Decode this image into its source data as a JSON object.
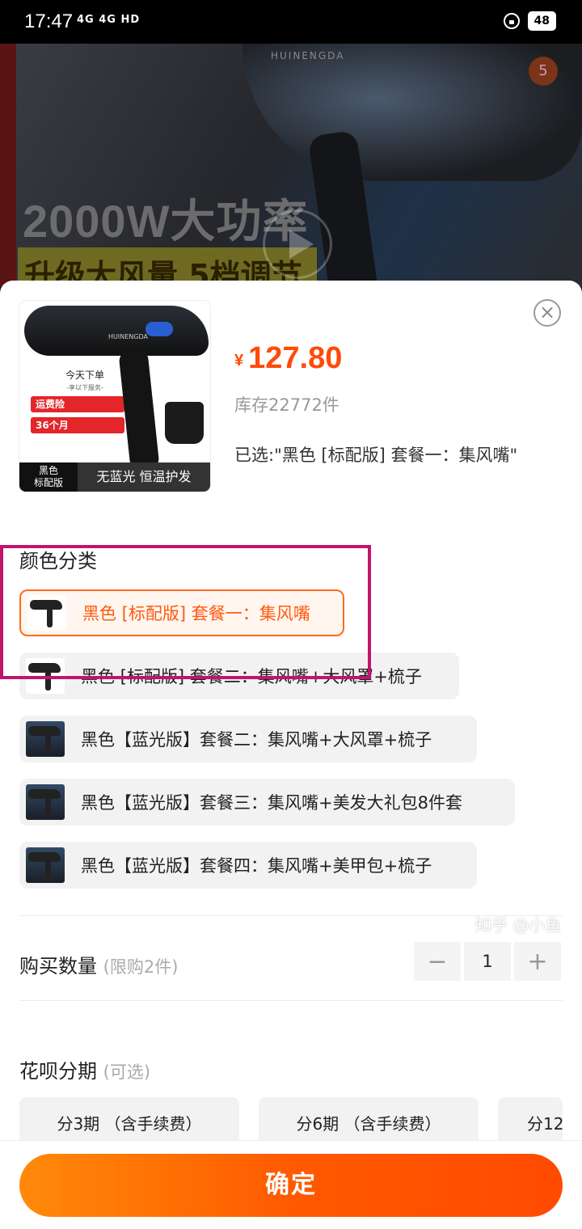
{
  "status_bar": {
    "time": "17:47",
    "signal": "4G 4G HD",
    "battery": "48"
  },
  "background": {
    "brand": "HUINENGDA",
    "headline": "2000W大功率",
    "subline": "升级大风量 5档调节",
    "badge_count": "5"
  },
  "sheet": {
    "close_label": "×",
    "thumbnail": {
      "brand": "HUINENGDA",
      "promo_title": "今天下单",
      "promo_sub": "-享以下服务-",
      "tag1": "运费险",
      "tag2": "36个月",
      "foot_left": "黑色\n标配版",
      "foot_right": "无蓝光 恒温护发"
    },
    "currency": "¥",
    "price": "127.80",
    "stock": "库存22772件",
    "selected": "已选:\"黑色 [标配版] 套餐一：集风嘴\"",
    "color_section_title": "颜色分类",
    "options": [
      {
        "label": "黑色 [标配版] 套餐一：集风嘴",
        "active": true
      },
      {
        "label": "黑色 [标配版] 套餐二：集风嘴+大风罩+梳子",
        "active": false
      },
      {
        "label": "黑色【蓝光版】套餐二：集风嘴+大风罩+梳子",
        "active": false
      },
      {
        "label": "黑色【蓝光版】套餐三：集风嘴+美发大礼包8件套",
        "active": false
      },
      {
        "label": "黑色【蓝光版】套餐四：集风嘴+美甲包+梳子",
        "active": false
      }
    ],
    "quantity_title": "购买数量",
    "quantity_hint": "(限购2件)",
    "quantity_minus": "−",
    "quantity_value": "1",
    "quantity_plus": "+",
    "installment_title": "花呗分期",
    "installment_hint": "(可选)",
    "installments": [
      "分3期 （含手续费）",
      "分6期 （含手续费）",
      "分12"
    ],
    "confirm_label": "确定"
  },
  "watermark": "知乎 @小鱼",
  "colors": {
    "accent": "#ff5a0f",
    "annotation": "#c0146e"
  }
}
